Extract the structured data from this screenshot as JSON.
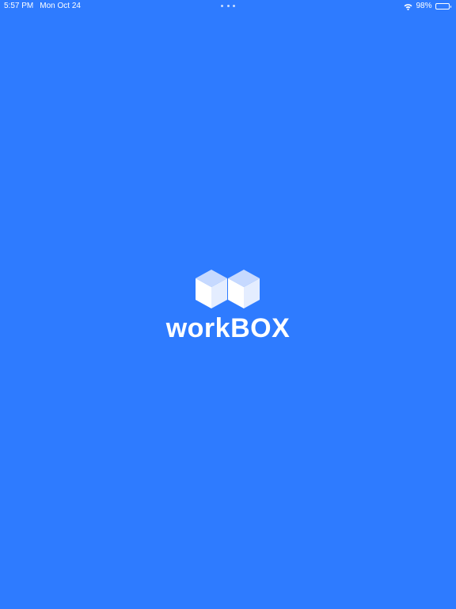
{
  "status_bar": {
    "time": "5:57 PM",
    "date": "Mon Oct 24",
    "battery_percent_label": "98%",
    "battery_level": 0.98,
    "icons": [
      "wifi-icon",
      "battery-icon",
      "multitasking-dots-icon"
    ]
  },
  "splash": {
    "app_name": "workBOX",
    "logo_icon": "cubes-logo-icon"
  },
  "colors": {
    "background": "#2e7bff",
    "foreground": "#ffffff",
    "cube_light": "#c6d9ff",
    "cube_mid": "#e4edff"
  }
}
